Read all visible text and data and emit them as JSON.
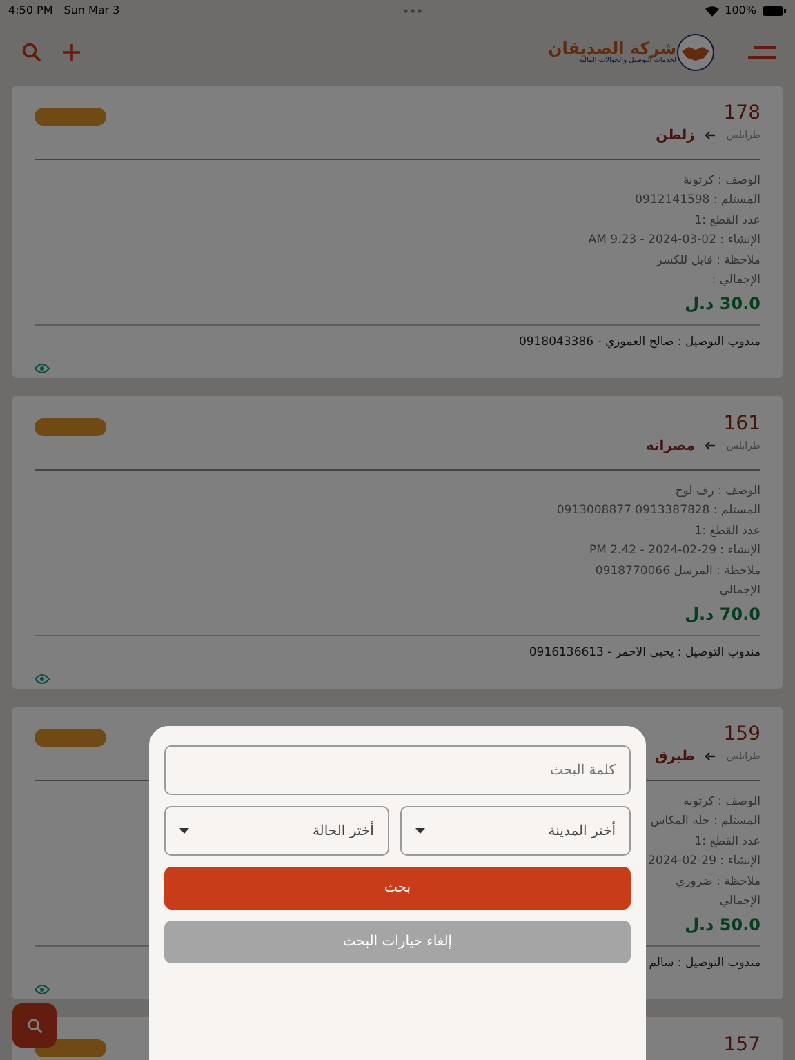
{
  "status_bar": {
    "time": "4:50 PM",
    "date": "Sun Mar 3",
    "battery": "100%"
  },
  "header": {
    "logo_title": "شركة الصديقان",
    "logo_subtitle": "لخدمات التوصيل والحوالات المالية"
  },
  "orders": [
    {
      "number": "178",
      "origin": "طرابلس",
      "destination": "زلطن",
      "details": [
        "الوصف : كرتونة",
        "المستلم : 0912141598",
        "عدد القطع :1",
        "الإنشاء : 02-03-2024 - 9.23 AM",
        "ملاحظة : قابل للكسر"
      ],
      "total_label": "الإجمالي :",
      "total": "30.0 د.ل",
      "agent": "مندوب التوصيل : صالح العموري - 0918043386"
    },
    {
      "number": "161",
      "origin": "طرابلس",
      "destination": "مصراته",
      "details": [
        "الوصف : رف لوح",
        "المستلم : 0913387828 0913008877",
        "عدد القطع :1",
        "الإنشاء : 29-02-2024 - 2.42 PM",
        "ملاحظة : المرسل 0918770066"
      ],
      "total_label": "الإجمالي",
      "total": "70.0 د.ل",
      "agent": "مندوب التوصيل : يحيى الاحمر - 0916136613"
    },
    {
      "number": "159",
      "origin": "طرابلس",
      "destination": "طبرق",
      "details": [
        "الوصف : كرتونه",
        "المستلم : حله المكاس",
        "عدد القطع :1",
        "الإنشاء : 29-02-2024",
        "ملاحظة : ضروري"
      ],
      "total_label": "الإجمالي",
      "total": "50.0 د.ل",
      "agent": "مندوب التوصيل : سالم"
    },
    {
      "number": "157"
    }
  ],
  "search_sheet": {
    "keyword_placeholder": "كلمة البحث",
    "city_placeholder": "أختر المدينة",
    "status_placeholder": "أختر الحالة",
    "search_button": "بحث",
    "cancel_button": "إلغاء خيارات البحث"
  }
}
